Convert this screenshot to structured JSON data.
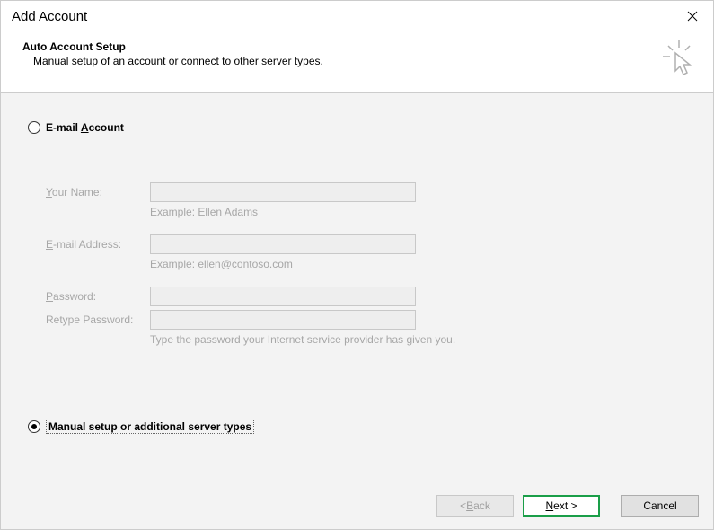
{
  "window": {
    "title": "Add Account"
  },
  "header": {
    "heading": "Auto Account Setup",
    "subtext": "Manual setup of an account or connect to other server types."
  },
  "radios": {
    "email_prefix": "E-mail ",
    "email_underline": "A",
    "email_suffix": "ccount",
    "manual_text": "Manual setup or additional server types"
  },
  "form": {
    "your_name_prefix": "Y",
    "your_name_suffix": "our Name:",
    "your_name_hint": "Example: Ellen Adams",
    "email_prefix": "E",
    "email_suffix": "-mail Address:",
    "email_hint": "Example: ellen@contoso.com",
    "password_prefix": "P",
    "password_suffix": "assword:",
    "retype_prefix": "Retype Password:",
    "password_hint": "Type the password your Internet service provider has given you."
  },
  "footer": {
    "back_prefix": "< ",
    "back_underline": "B",
    "back_suffix": "ack",
    "next_underline": "N",
    "next_suffix": "ext >",
    "cancel": "Cancel"
  }
}
